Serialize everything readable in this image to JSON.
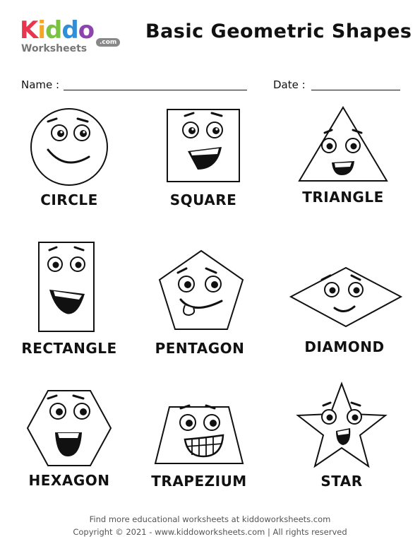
{
  "logo": {
    "letters": [
      "K",
      "i",
      "d",
      "d",
      "o"
    ],
    "letter_colors": [
      "#e8364f",
      "#f5a623",
      "#7cc242",
      "#2f8fd8",
      "#8e44ad"
    ],
    "subtitle": "Worksheets",
    "domain_badge": ".com"
  },
  "title": "Basic Geometric Shapes",
  "fields": {
    "name_label": "Name :",
    "date_label": "Date :"
  },
  "shapes": [
    {
      "label": "CIRCLE",
      "icon": "circle-face"
    },
    {
      "label": "SQUARE",
      "icon": "square-face"
    },
    {
      "label": "TRIANGLE",
      "icon": "triangle-face"
    },
    {
      "label": "RECTANGLE",
      "icon": "rectangle-face"
    },
    {
      "label": "PENTAGON",
      "icon": "pentagon-face"
    },
    {
      "label": "DIAMOND",
      "icon": "diamond-face"
    },
    {
      "label": "HEXAGON",
      "icon": "hexagon-face"
    },
    {
      "label": "TRAPEZIUM",
      "icon": "trapezium-face"
    },
    {
      "label": "STAR",
      "icon": "star-face"
    }
  ],
  "footer": {
    "line1": "Find more educational worksheets at kiddoworksheets.com",
    "line2": "Copyright © 2021 - www.kiddoworksheets.com  |  All rights reserved"
  }
}
